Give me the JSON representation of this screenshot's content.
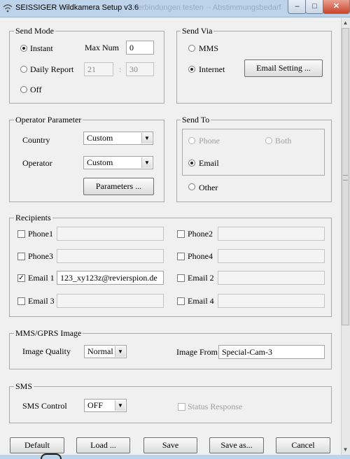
{
  "window": {
    "title": "SEISSIGER Wildkamera Setup v3.6",
    "ghost_text": "Verbindungen testen ·· Abstimmungsbedarf"
  },
  "send_mode": {
    "legend": "Send Mode",
    "instant": "Instant",
    "max_num_label": "Max Num",
    "max_num_value": "0",
    "daily_report": "Daily Report",
    "daily_hour": "21",
    "separator": ":",
    "daily_minute": "30",
    "off": "Off"
  },
  "send_via": {
    "legend": "Send Via",
    "mms": "MMS",
    "internet": "Internet",
    "email_setting_button": "Email Setting ..."
  },
  "operator": {
    "legend": "Operator Parameter",
    "country_label": "Country",
    "country_value": "Custom",
    "operator_label": "Operator",
    "operator_value": "Custom",
    "parameters_button": "Parameters ..."
  },
  "send_to": {
    "legend": "Send To",
    "phone": "Phone",
    "both": "Both",
    "email": "Email",
    "other": "Other"
  },
  "recipients": {
    "legend": "Recipients",
    "phone1": "Phone1",
    "phone2": "Phone2",
    "phone3": "Phone3",
    "phone4": "Phone4",
    "email1": "Email 1",
    "email1_value": "123_xy123z@revierspion.de",
    "email2": "Email 2",
    "email3": "Email 3",
    "email4": "Email 4"
  },
  "image": {
    "legend": "MMS/GPRS Image",
    "quality_label": "Image Quality",
    "quality_value": "Normal",
    "from_label": "Image From",
    "from_value": "Special-Cam-3"
  },
  "sms": {
    "legend": "SMS",
    "control_label": "SMS Control",
    "control_value": "OFF",
    "status_response": "Status Response"
  },
  "buttons": {
    "default": "Default",
    "load": "Load ...",
    "save": "Save",
    "save_as": "Save as...",
    "cancel": "Cancel"
  },
  "icons": {
    "app": "wifi-signal-icon",
    "combo": "chevron-down-icon"
  }
}
